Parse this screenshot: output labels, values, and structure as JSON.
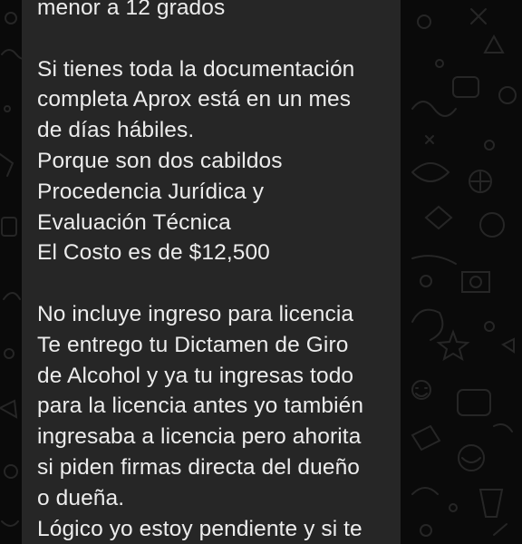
{
  "message": {
    "lines": [
      "menor a 12 grados",
      "",
      "Si tienes toda la documentación",
      "completa Aprox está en un mes",
      "de días hábiles.",
      "Porque son dos cabildos",
      "Procedencia Jurídica y",
      "Evaluación Técnica",
      "El Costo es de $12,500",
      "",
      "No incluye ingreso para licencia",
      "Te entrego tu Dictamen de Giro",
      "de Alcohol y ya tu ingresas todo",
      "para la licencia antes yo también",
      "ingresaba a licencia pero ahorita",
      "si piden firmas directa del dueño",
      "o dueña.",
      "Lógico yo estoy pendiente y si te"
    ]
  },
  "theme": {
    "background": "#0a0a0a",
    "bubble": "#262626",
    "text": "#ececec",
    "doodle": "#2a2a2a"
  }
}
